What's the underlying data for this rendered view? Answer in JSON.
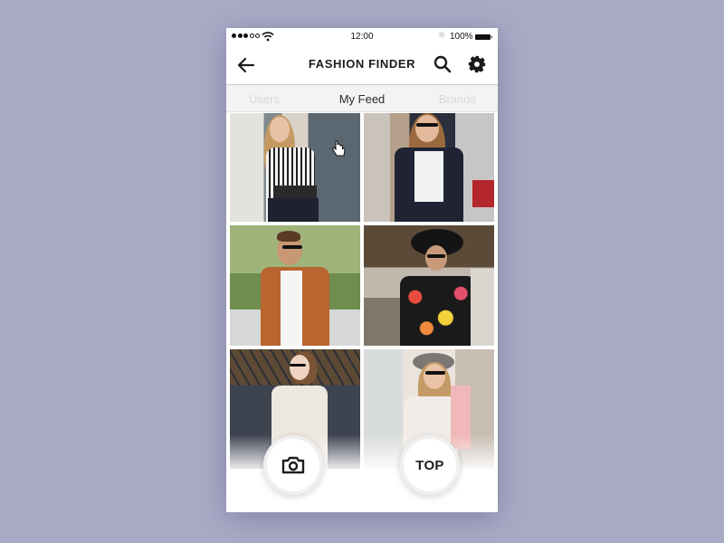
{
  "status_bar": {
    "signal_filled": 3,
    "signal_total": 5,
    "time": "12:00",
    "bluetooth_icon": "bluetooth-icon",
    "battery_percent": "100%"
  },
  "nav": {
    "back_icon": "arrow-left-icon",
    "title": "FASHION FINDER",
    "search_icon": "search-icon",
    "settings_icon": "gear-icon"
  },
  "tabs": [
    {
      "label": "Users",
      "active": false
    },
    {
      "label": "My Feed",
      "active": true
    },
    {
      "label": "Brands",
      "active": false
    }
  ],
  "feed": {
    "items": [
      {
        "description": "Woman with blonde hair in black-and-white striped shirt and embellished belt"
      },
      {
        "description": "Woman in sunglasses, white tee and navy blazer on street"
      },
      {
        "description": "Man in sunglasses and tan leather jacket with trees behind"
      },
      {
        "description": "Woman in black wide-brim hat and colorful crochet top"
      },
      {
        "description": "Woman with glasses and ponytail in cream sweater by iron gate"
      },
      {
        "description": "Woman in gray fedora and sunglasses with white top and crossbody bag"
      }
    ]
  },
  "actions": {
    "camera_icon": "camera-icon",
    "top_label": "TOP"
  },
  "colors": {
    "background": "#a9aac6",
    "title_text": "#1b1b1b",
    "tab_active": "#2b2b2b",
    "tab_inactive": "#d8d8d8"
  }
}
